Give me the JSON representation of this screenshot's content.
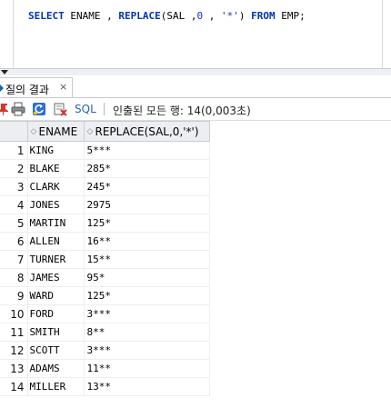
{
  "editor": {
    "sql_tokens": [
      {
        "text": "SELECT",
        "type": "kw"
      },
      {
        "text": " ENAME , ",
        "type": "plain"
      },
      {
        "text": "REPLACE",
        "type": "fn"
      },
      {
        "text": "(SAL ,",
        "type": "plain"
      },
      {
        "text": "0",
        "type": "num"
      },
      {
        "text": " , ",
        "type": "plain"
      },
      {
        "text": "'*'",
        "type": "str"
      },
      {
        "text": ") ",
        "type": "plain"
      },
      {
        "text": "FROM",
        "type": "kw"
      },
      {
        "text": " EMP;",
        "type": "plain"
      }
    ]
  },
  "results_tab": {
    "label": "질의 결과",
    "close_symbol": "×"
  },
  "toolbar": {
    "icons": [
      "pin-icon",
      "print-icon",
      "refresh-icon",
      "export-icon"
    ],
    "sql_label": "SQL",
    "status_text": "인출된 모든 행: 14(0,003초)"
  },
  "grid": {
    "columns": [
      "ENAME",
      "REPLACE(SAL,0,'*')"
    ],
    "rows": [
      {
        "num": "1",
        "ename": "KING",
        "replaced": "5***"
      },
      {
        "num": "2",
        "ename": "BLAKE",
        "replaced": "285*"
      },
      {
        "num": "3",
        "ename": "CLARK",
        "replaced": "245*"
      },
      {
        "num": "4",
        "ename": "JONES",
        "replaced": "2975"
      },
      {
        "num": "5",
        "ename": "MARTIN",
        "replaced": "125*"
      },
      {
        "num": "6",
        "ename": "ALLEN",
        "replaced": "16**"
      },
      {
        "num": "7",
        "ename": "TURNER",
        "replaced": "15**"
      },
      {
        "num": "8",
        "ename": "JAMES",
        "replaced": "95*"
      },
      {
        "num": "9",
        "ename": "WARD",
        "replaced": "125*"
      },
      {
        "num": "10",
        "ename": "FORD",
        "replaced": "3***"
      },
      {
        "num": "11",
        "ename": "SMITH",
        "replaced": "8**"
      },
      {
        "num": "12",
        "ename": "SCOTT",
        "replaced": "3***"
      },
      {
        "num": "13",
        "ename": "ADAMS",
        "replaced": "11**"
      },
      {
        "num": "14",
        "ename": "MILLER",
        "replaced": "13**"
      }
    ]
  }
}
